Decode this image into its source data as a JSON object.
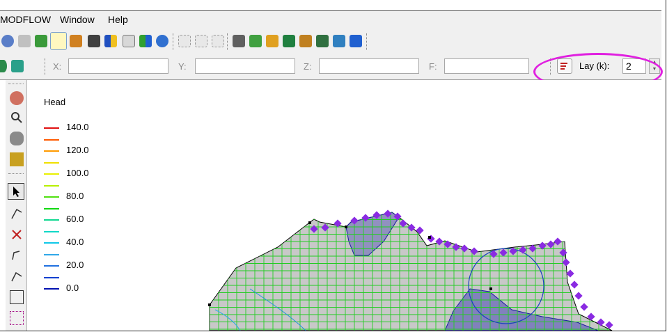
{
  "menu": {
    "items": [
      "MODFLOW",
      "Window",
      "Help"
    ]
  },
  "coords": {
    "x_label": "X:",
    "y_label": "Y:",
    "z_label": "Z:",
    "f_label": "F:",
    "x_value": "",
    "y_value": "",
    "z_value": "",
    "f_value": ""
  },
  "layer": {
    "label": "Lay (k):",
    "value": "2"
  },
  "legend": {
    "title": "Head",
    "entries": [
      {
        "label": "140.0",
        "color": "#e01010"
      },
      {
        "label": "",
        "color": "#ff5a00"
      },
      {
        "label": "120.0",
        "color": "#ff9a00"
      },
      {
        "label": "",
        "color": "#f0e000"
      },
      {
        "label": "100.0",
        "color": "#e8f000"
      },
      {
        "label": "",
        "color": "#b8f000"
      },
      {
        "label": "80.0",
        "color": "#50e010"
      },
      {
        "label": "",
        "color": "#10d810"
      },
      {
        "label": "60.0",
        "color": "#10d890"
      },
      {
        "label": "",
        "color": "#10d8c8"
      },
      {
        "label": "40.0",
        "color": "#10c8e8"
      },
      {
        "label": "",
        "color": "#30a8e8"
      },
      {
        "label": "20.0",
        "color": "#2070e0"
      },
      {
        "label": "",
        "color": "#1040d0"
      },
      {
        "label": "0.0",
        "color": "#0010b0"
      }
    ]
  },
  "colors": {
    "highlight": "#e020e0",
    "grid": "#22cc22",
    "domain_fill": "#c8c8c8",
    "inactive": "#1a1aa0",
    "boundary": "#8a2be2"
  }
}
